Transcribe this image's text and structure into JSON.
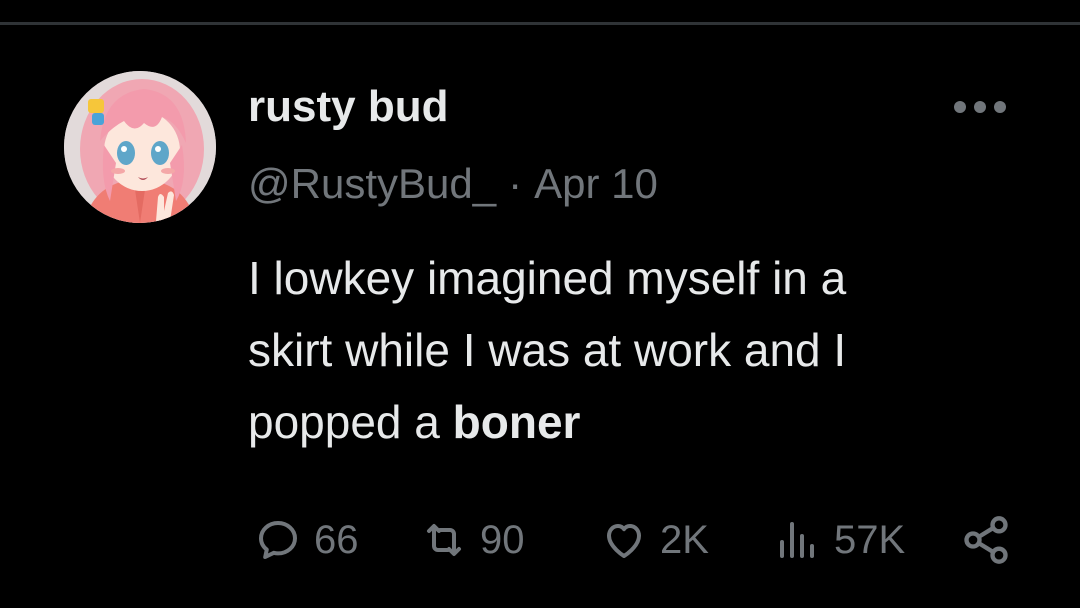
{
  "tweet": {
    "author": {
      "display_name": "rusty bud",
      "handle": "@RustyBud_",
      "avatar_icon": "anime-avatar"
    },
    "date": "Apr 10",
    "date_separator": "·",
    "more_icon": "more-horizontal-icon",
    "text": {
      "line1": "I lowkey imagined myself in a",
      "line2": "skirt while I was at work and I",
      "line3_prefix": "popped a",
      "line3_bold": "boner"
    },
    "stats": {
      "replies": "66",
      "retweets": "90",
      "likes": "2K",
      "views": "57K"
    }
  },
  "colors": {
    "background": "#000000",
    "primary_text": "#e7e9ea",
    "secondary_text": "#71767b",
    "divider": "#2f3336"
  }
}
